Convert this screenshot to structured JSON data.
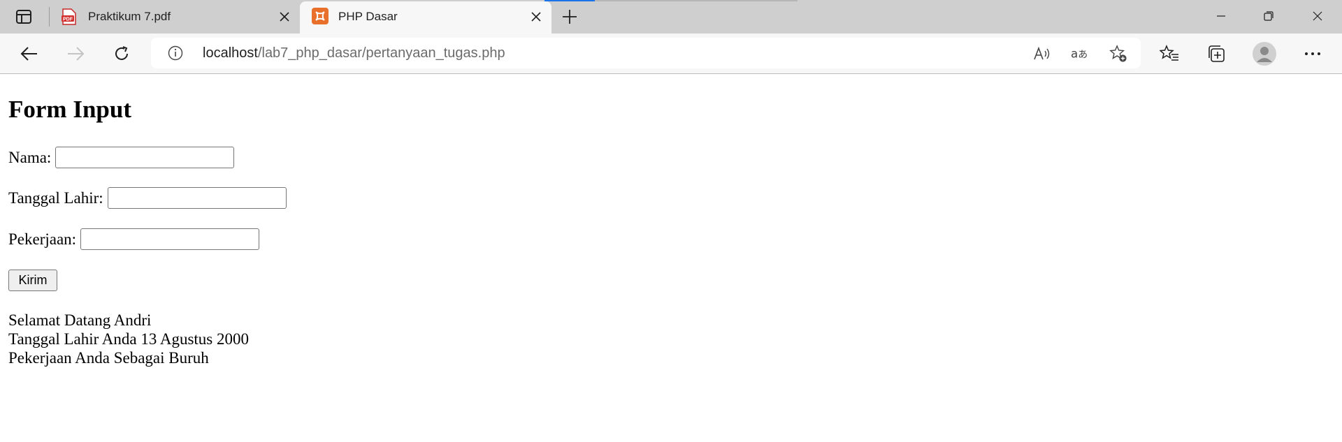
{
  "browser": {
    "tabs": [
      {
        "title": "Praktikum 7.pdf",
        "favicon": "pdf-icon",
        "active": false
      },
      {
        "title": "PHP Dasar",
        "favicon": "xampp-icon",
        "active": true
      }
    ],
    "url_host": "localhost",
    "url_path": "/lab7_php_dasar/pertanyaan_tugas.php",
    "accent_color": "#1a73e8"
  },
  "page": {
    "heading": "Form Input",
    "form": {
      "nama_label": "Nama:",
      "nama_value": "",
      "tanggal_label": "Tanggal Lahir:",
      "tanggal_value": "",
      "pekerjaan_label": "Pekerjaan:",
      "pekerjaan_value": "",
      "submit_label": "Kirim"
    },
    "result": {
      "line1": "Selamat Datang Andri",
      "line2": "Tanggal Lahir Anda 13 Agustus 2000",
      "line3": "Pekerjaan Anda Sebagai Buruh"
    }
  }
}
